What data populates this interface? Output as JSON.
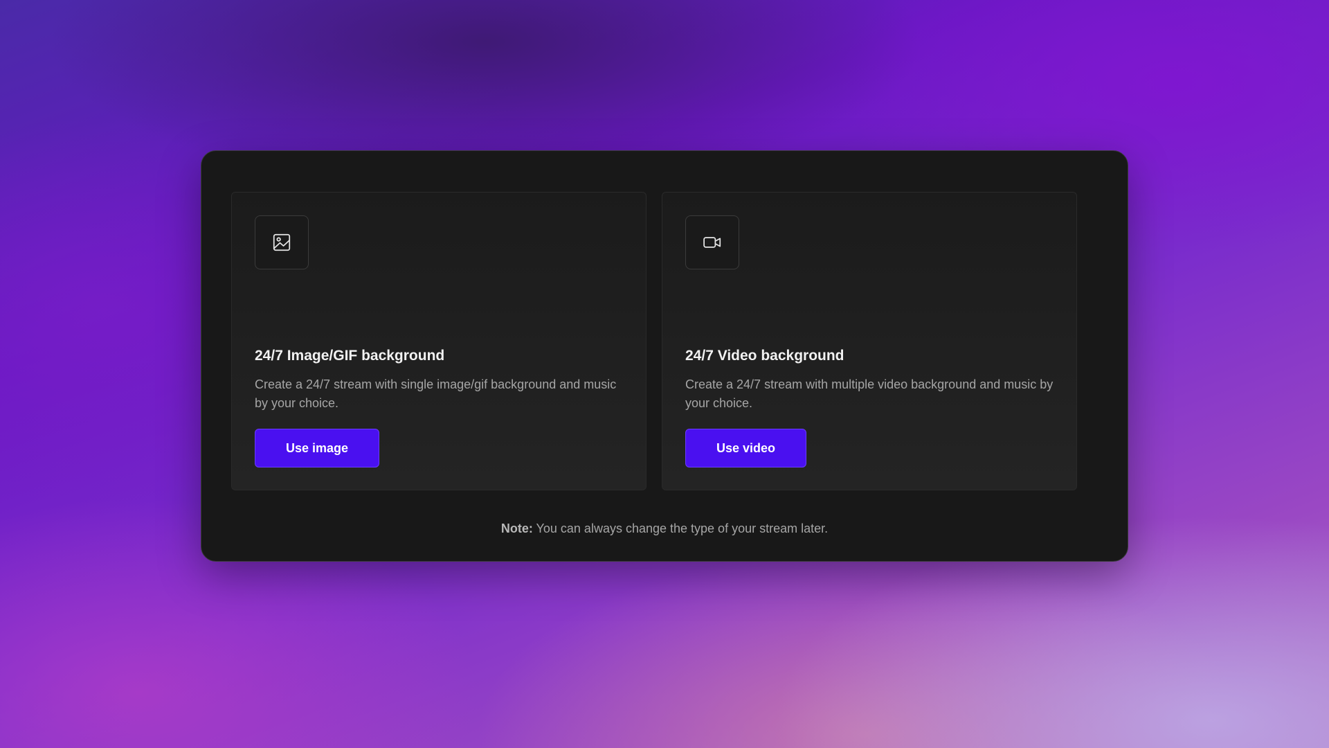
{
  "cards": [
    {
      "icon": "image-icon",
      "title": "24/7 Image/GIF background",
      "description": "Create a 24/7 stream with single image/gif background and music by your choice.",
      "button_label": "Use image"
    },
    {
      "icon": "video-camera-icon",
      "title": "24/7 Video background",
      "description": "Create a 24/7 stream with multiple video background and music by your choice.",
      "button_label": "Use video"
    }
  ],
  "note": {
    "label": "Note:",
    "text": " You can always change the type of your stream later."
  },
  "colors": {
    "accent": "#4a10f0",
    "modal_background": "#181818",
    "card_background": "#202020"
  }
}
